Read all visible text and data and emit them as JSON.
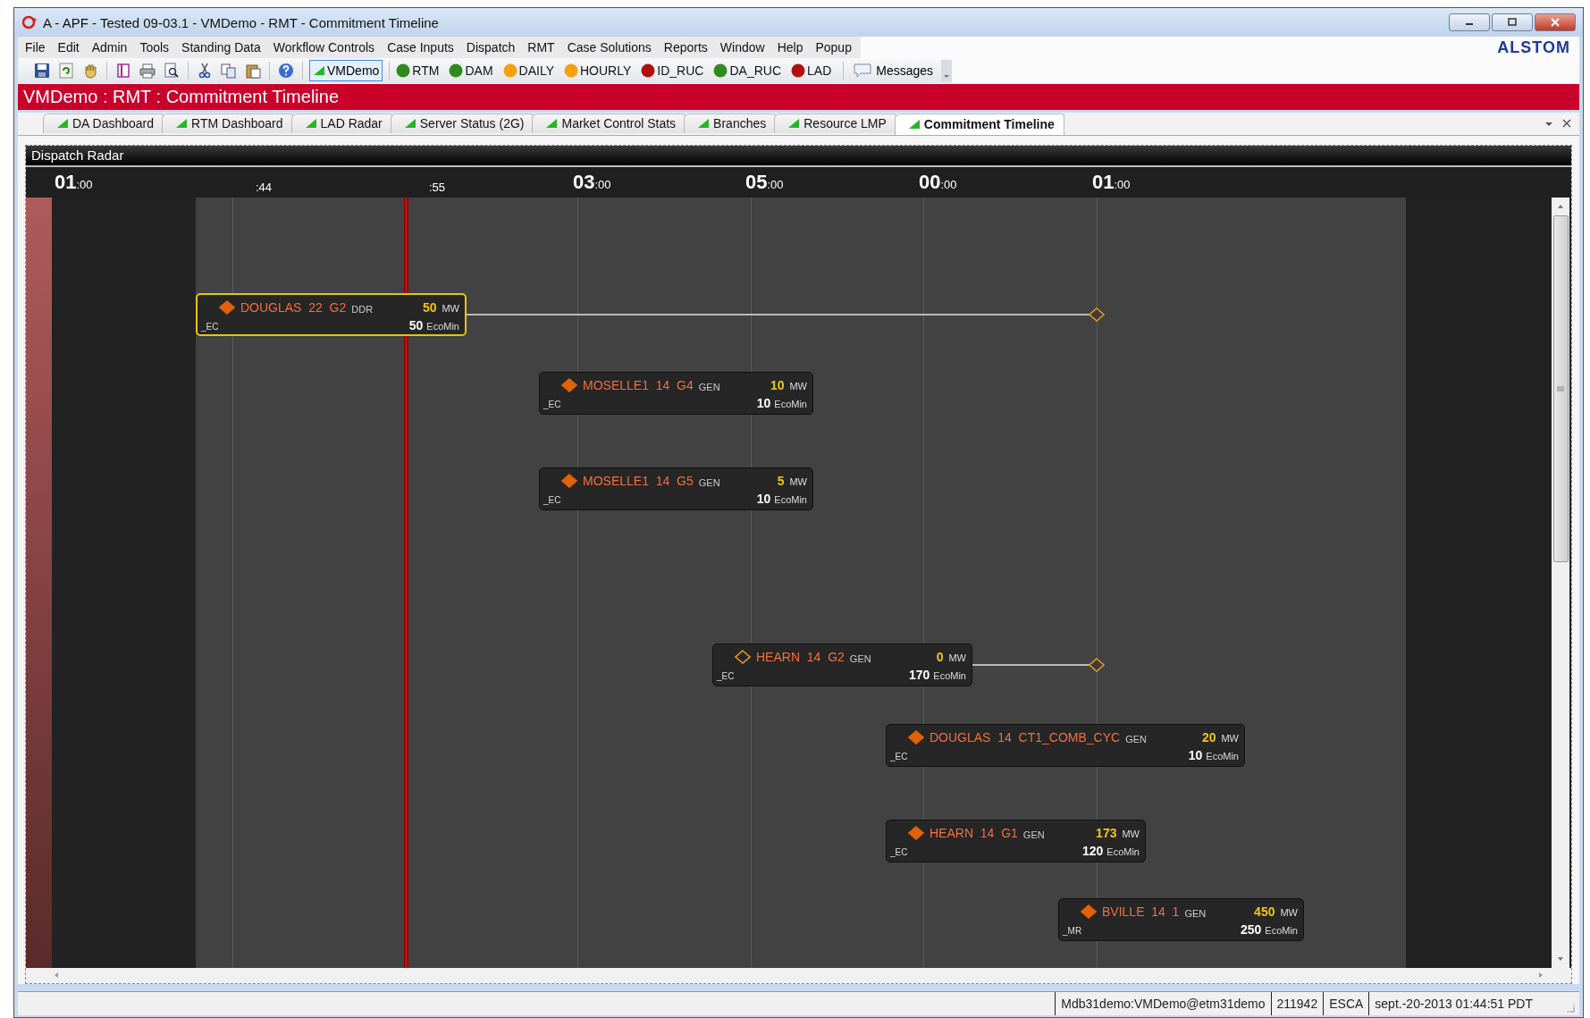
{
  "window": {
    "title": "A - APF -  Tested 09-03.1 - VMDemo - RMT - Commitment Timeline",
    "logo": "ALSTOM"
  },
  "menu": [
    "File",
    "Edit",
    "Admin",
    "Tools",
    "Standing Data",
    "Workflow Controls",
    "Case Inputs",
    "Dispatch",
    "RMT",
    "Case Solutions",
    "Reports",
    "Window",
    "Help",
    "Popup"
  ],
  "toolbar": {
    "context_button": {
      "label": "VMDemo",
      "selected": true
    },
    "indicators": [
      {
        "label": "RTM",
        "color": "#2e8b1e"
      },
      {
        "label": "DAM",
        "color": "#2e8b1e"
      },
      {
        "label": "DAILY",
        "color": "#f5a10f"
      },
      {
        "label": "HOURLY",
        "color": "#f5a10f"
      },
      {
        "label": "ID_RUC",
        "color": "#b01010"
      },
      {
        "label": "DA_RUC",
        "color": "#2e8b1e"
      },
      {
        "label": "LAD",
        "color": "#b01010"
      }
    ],
    "messages": "Messages"
  },
  "header": "VMDemo  :  RMT  :  Commitment Timeline",
  "tabs": [
    {
      "label": "DA Dashboard",
      "selected": false
    },
    {
      "label": "RTM Dashboard",
      "selected": false
    },
    {
      "label": "LAD Radar",
      "selected": false
    },
    {
      "label": "Server Status (2G)",
      "selected": false
    },
    {
      "label": "Market Control Stats",
      "selected": false
    },
    {
      "label": "Branches",
      "selected": false
    },
    {
      "label": "Resource LMP",
      "selected": false
    },
    {
      "label": "Commitment Timeline",
      "selected": true
    }
  ],
  "panel": {
    "title": "Dispatch Radar",
    "time_labels": [
      {
        "hour": "01",
        "minutes": ":00"
      },
      {
        "minutes": ":44"
      },
      {
        "minutes": ":55"
      },
      {
        "hour": "03",
        "minutes": ":00"
      },
      {
        "hour": "05",
        "minutes": ":00"
      },
      {
        "hour": "00",
        "minutes": ":00"
      },
      {
        "hour": "01",
        "minutes": ":00"
      }
    ],
    "units": [
      {
        "name": "DOUGLAS  22  G2",
        "type": "DDR",
        "mw": "50",
        "mw_unit": "MW",
        "zone": "_EC",
        "ecomin": "50",
        "ecomin_unit": "EcoMin",
        "hollow": false,
        "selected": true,
        "extends": true
      },
      {
        "name": "MOSELLE1  14  G4",
        "type": "GEN",
        "mw": "10",
        "mw_unit": "MW",
        "zone": "_EC",
        "ecomin": "10",
        "ecomin_unit": "EcoMin",
        "hollow": false,
        "selected": false,
        "extends": false
      },
      {
        "name": "MOSELLE1  14  G5",
        "type": "GEN",
        "mw": "5",
        "mw_unit": "MW",
        "zone": "_EC",
        "ecomin": "10",
        "ecomin_unit": "EcoMin",
        "hollow": false,
        "selected": false,
        "extends": false
      },
      {
        "name": "HEARN  14  G2",
        "type": "GEN",
        "mw": "0",
        "mw_unit": "MW",
        "zone": "_EC",
        "ecomin": "170",
        "ecomin_unit": "EcoMin",
        "hollow": true,
        "selected": false,
        "extends": true
      },
      {
        "name": "DOUGLAS  14  CT1_COMB_CYC",
        "type": "GEN",
        "mw": "20",
        "mw_unit": "MW",
        "zone": "_EC",
        "ecomin": "10",
        "ecomin_unit": "EcoMin",
        "hollow": false,
        "selected": false,
        "extends": false
      },
      {
        "name": "HEARN  14  G1",
        "type": "GEN",
        "mw": "173",
        "mw_unit": "MW",
        "zone": "_EC",
        "ecomin": "120",
        "ecomin_unit": "EcoMin",
        "hollow": false,
        "selected": false,
        "extends": false
      },
      {
        "name": "BVILLE  14  1",
        "type": "GEN",
        "mw": "450",
        "mw_unit": "MW",
        "zone": "_MR",
        "ecomin": "250",
        "ecomin_unit": "EcoMin",
        "hollow": false,
        "selected": false,
        "extends": false
      }
    ]
  },
  "status_bar": [
    "Mdb31demo:VMDemo@etm31demo",
    "211942",
    "ESCA",
    "sept.-20-2013 01:44:51 PDT"
  ]
}
